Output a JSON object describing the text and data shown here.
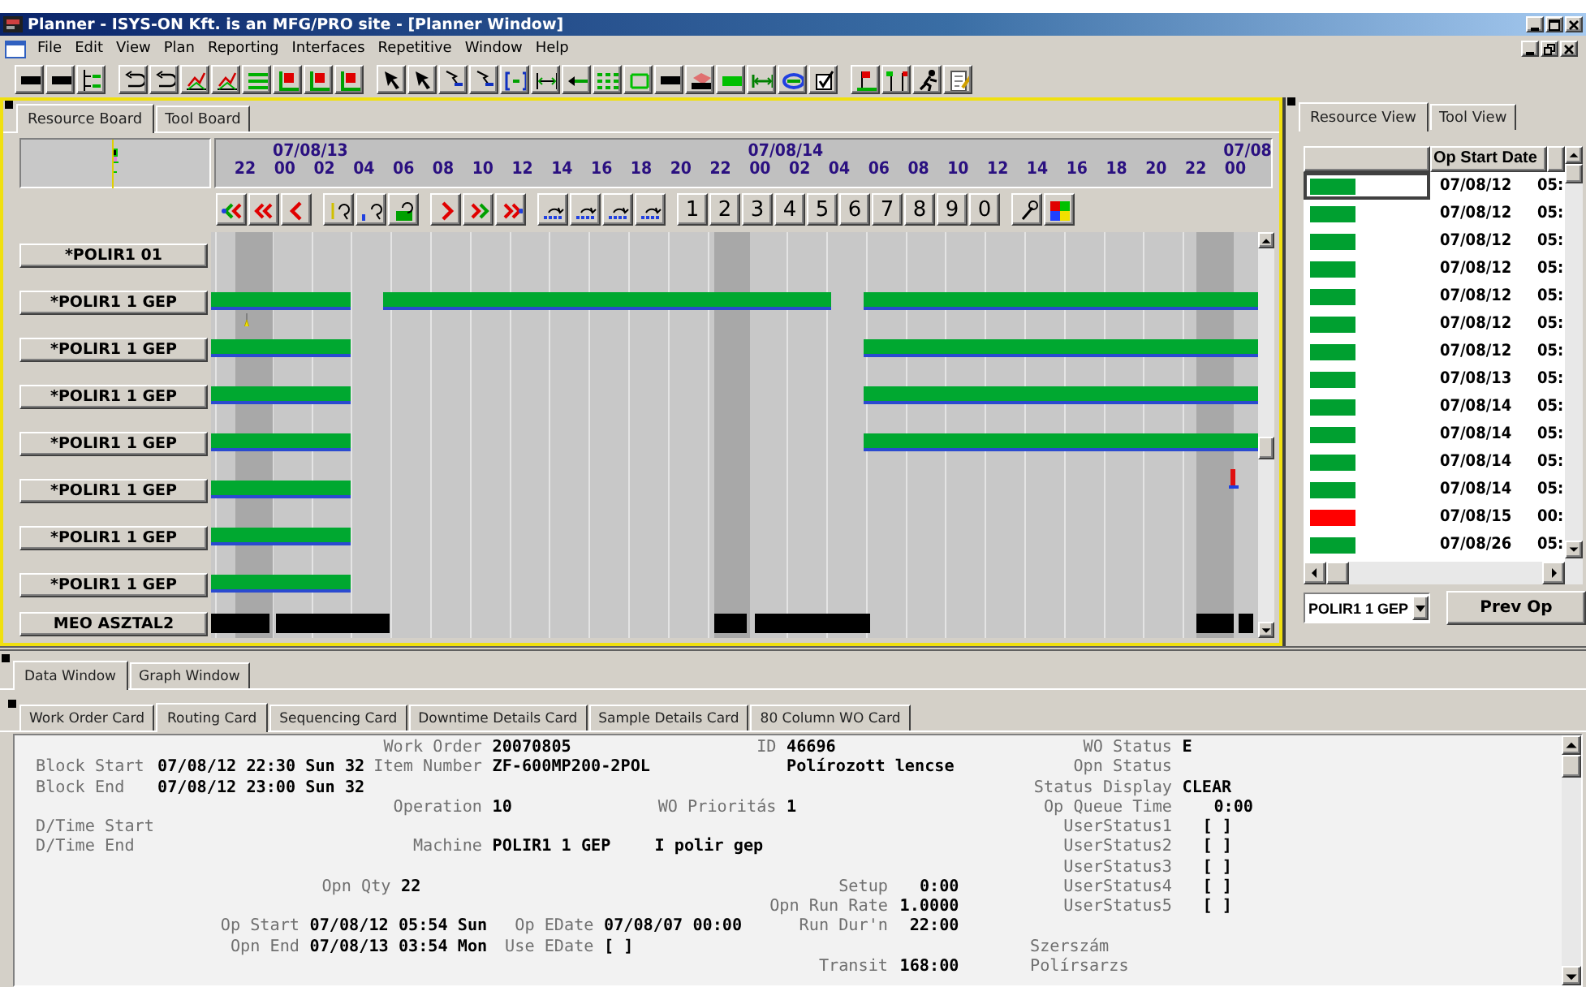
{
  "window": {
    "title": "Planner - ISYS-ON Kft. is an MFG/PRO site - [Planner Window]"
  },
  "menu": [
    "File",
    "Edit",
    "View",
    "Plan",
    "Reporting",
    "Interfaces",
    "Repetitive",
    "Window",
    "Help"
  ],
  "board": {
    "tabs": [
      {
        "label": "Resource Board",
        "selected": true
      },
      {
        "label": "Tool Board",
        "selected": false
      }
    ],
    "dates": [
      "07/08/13",
      "07/08/14",
      "07/08"
    ],
    "hours": [
      "22",
      "00",
      "02",
      "04",
      "06",
      "08",
      "10",
      "12",
      "14",
      "16",
      "18",
      "20",
      "22",
      "00",
      "02",
      "04",
      "06",
      "08",
      "10",
      "12",
      "14",
      "16",
      "18",
      "20",
      "22",
      "00"
    ],
    "digit_buttons": [
      "1",
      "2",
      "3",
      "4",
      "5",
      "6",
      "7",
      "8",
      "9",
      "0"
    ],
    "resources": [
      {
        "label": "*POLIR1 01"
      },
      {
        "label": "*POLIR1 1 GEP",
        "bars": [
          {
            "kind": "operation"
          },
          {
            "kind": "operation"
          },
          {
            "kind": "operation"
          }
        ],
        "markers": [
          {
            "kind": "pin"
          }
        ]
      },
      {
        "label": "*POLIR1 1 GEP",
        "bars": [
          {
            "kind": "operation"
          },
          {
            "kind": "operation"
          }
        ]
      },
      {
        "label": "*POLIR1 1 GEP",
        "bars": [
          {
            "kind": "operation"
          },
          {
            "kind": "operation"
          }
        ]
      },
      {
        "label": "*POLIR1 1 GEP",
        "bars": [
          {
            "kind": "operation"
          },
          {
            "kind": "operation"
          }
        ]
      },
      {
        "label": "*POLIR1 1 GEP",
        "bars": [
          {
            "kind": "operation"
          }
        ],
        "markers": [
          {
            "kind": "alert"
          }
        ]
      },
      {
        "label": "*POLIR1 1 GEP",
        "bars": [
          {
            "kind": "operation"
          }
        ]
      },
      {
        "label": "*POLIR1 1 GEP",
        "bars": [
          {
            "kind": "operation"
          }
        ]
      },
      {
        "label": "MEO ASZTAL2",
        "bars": [
          {
            "kind": "downtime"
          },
          {
            "kind": "downtime"
          },
          {
            "kind": "downtime"
          },
          {
            "kind": "downtime"
          },
          {
            "kind": "downtime"
          },
          {
            "kind": "downtime"
          }
        ]
      }
    ]
  },
  "resource_view": {
    "tabs": [
      {
        "label": "Resource View",
        "selected": true
      },
      {
        "label": "Tool View",
        "selected": false
      }
    ],
    "date_column": "Op Start Date",
    "rows": [
      {
        "color": "#00a030",
        "date": "07/08/12",
        "time": "05:",
        "selected": true
      },
      {
        "color": "#00a030",
        "date": "07/08/12",
        "time": "05:",
        "selected": false
      },
      {
        "color": "#00a030",
        "date": "07/08/12",
        "time": "05:",
        "selected": false
      },
      {
        "color": "#00a030",
        "date": "07/08/12",
        "time": "05:",
        "selected": false
      },
      {
        "color": "#00a030",
        "date": "07/08/12",
        "time": "05:",
        "selected": false
      },
      {
        "color": "#00a030",
        "date": "07/08/12",
        "time": "05:",
        "selected": false
      },
      {
        "color": "#00a030",
        "date": "07/08/12",
        "time": "05:",
        "selected": false
      },
      {
        "color": "#00a030",
        "date": "07/08/13",
        "time": "05:",
        "selected": false
      },
      {
        "color": "#00a030",
        "date": "07/08/14",
        "time": "05:",
        "selected": false
      },
      {
        "color": "#00a030",
        "date": "07/08/14",
        "time": "05:",
        "selected": false
      },
      {
        "color": "#00a030",
        "date": "07/08/14",
        "time": "05:",
        "selected": false
      },
      {
        "color": "#00a030",
        "date": "07/08/14",
        "time": "05:",
        "selected": false
      },
      {
        "color": "#ff0000",
        "date": "07/08/15",
        "time": "00:",
        "selected": false
      },
      {
        "color": "#00a030",
        "date": "07/08/26",
        "time": "05:",
        "selected": false
      }
    ],
    "resource_select": "POLIR1 1 GEP",
    "button": "Prev Op"
  },
  "data_window": {
    "tabs": [
      {
        "label": "Data Window",
        "selected": true
      },
      {
        "label": "Graph Window",
        "selected": false
      }
    ],
    "cards": [
      {
        "label": "Work Order Card",
        "selected": false
      },
      {
        "label": "Routing Card",
        "selected": true
      },
      {
        "label": "Sequencing Card",
        "selected": false
      },
      {
        "label": "Downtime Details Card",
        "selected": false
      },
      {
        "label": "Sample Details Card",
        "selected": false
      },
      {
        "label": "80 Column WO Card",
        "selected": false
      }
    ],
    "fields": [
      {
        "label": "Work Order",
        "value": "20070805"
      },
      {
        "label": "ID",
        "value": "46696"
      },
      {
        "label": "WO Status",
        "value": "E"
      },
      {
        "label": "Block Start",
        "value": "07/08/12 22:30 Sun 32"
      },
      {
        "label": "Item Number",
        "value": "ZF-600MP200-2POL"
      },
      {
        "value": "Polírozott lencse"
      },
      {
        "label": "Opn Status"
      },
      {
        "label": "Block End",
        "value": "07/08/12 23:00 Sun 32"
      },
      {
        "label": "Status Display",
        "value": "CLEAR"
      },
      {
        "label": "Operation",
        "value": "10"
      },
      {
        "label": "WO Prioritás",
        "value": "1"
      },
      {
        "label": "Op Queue Time",
        "value": "0:00"
      },
      {
        "label": "D/Time Start"
      },
      {
        "label": "UserStatus1",
        "value": "[ ]"
      },
      {
        "label": "D/Time End"
      },
      {
        "label": "Machine",
        "value": "POLIR1 1 GEP"
      },
      {
        "value": "I polir gep"
      },
      {
        "label": "UserStatus2",
        "value": "[ ]"
      },
      {
        "label": "UserStatus3",
        "value": "[ ]"
      },
      {
        "label": "Opn Qty",
        "value": "22"
      },
      {
        "label": "Setup",
        "value": "0:00"
      },
      {
        "label": "UserStatus4",
        "value": "[ ]"
      },
      {
        "label": "Opn Run Rate",
        "value": "1.0000"
      },
      {
        "label": "UserStatus5",
        "value": "[ ]"
      },
      {
        "label": "Op Start",
        "value": "07/08/12 05:54 Sun"
      },
      {
        "label": "Op EDate",
        "value": "07/08/07 00:00"
      },
      {
        "label": "Run Dur'n",
        "value": "22:00"
      },
      {
        "label": "Opn End",
        "value": "07/08/13 03:54 Mon"
      },
      {
        "label": "Use EDate",
        "value": "[ ]"
      },
      {
        "label": "Szerszám"
      },
      {
        "label": "Transit",
        "value": "168:00"
      },
      {
        "label": "Polírsarzs"
      }
    ]
  }
}
